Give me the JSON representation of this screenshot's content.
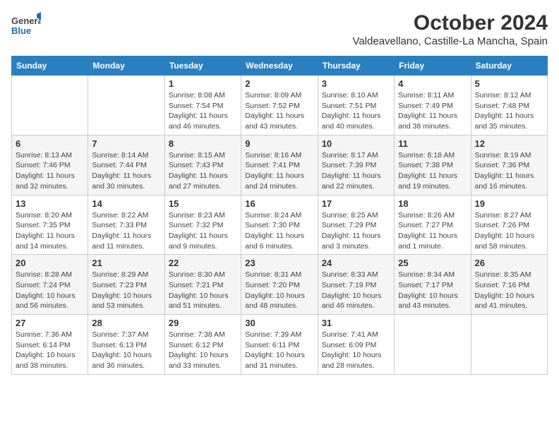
{
  "header": {
    "logo_general": "General",
    "logo_blue": "Blue",
    "title": "October 2024",
    "subtitle": "Valdeavellano, Castille-La Mancha, Spain"
  },
  "calendar": {
    "days_of_week": [
      "Sunday",
      "Monday",
      "Tuesday",
      "Wednesday",
      "Thursday",
      "Friday",
      "Saturday"
    ],
    "weeks": [
      [
        {
          "day": "",
          "sunrise": "",
          "sunset": "",
          "daylight": ""
        },
        {
          "day": "",
          "sunrise": "",
          "sunset": "",
          "daylight": ""
        },
        {
          "day": "1",
          "sunrise": "Sunrise: 8:08 AM",
          "sunset": "Sunset: 7:54 PM",
          "daylight": "Daylight: 11 hours and 46 minutes."
        },
        {
          "day": "2",
          "sunrise": "Sunrise: 8:09 AM",
          "sunset": "Sunset: 7:52 PM",
          "daylight": "Daylight: 11 hours and 43 minutes."
        },
        {
          "day": "3",
          "sunrise": "Sunrise: 8:10 AM",
          "sunset": "Sunset: 7:51 PM",
          "daylight": "Daylight: 11 hours and 40 minutes."
        },
        {
          "day": "4",
          "sunrise": "Sunrise: 8:11 AM",
          "sunset": "Sunset: 7:49 PM",
          "daylight": "Daylight: 11 hours and 38 minutes."
        },
        {
          "day": "5",
          "sunrise": "Sunrise: 8:12 AM",
          "sunset": "Sunset: 7:48 PM",
          "daylight": "Daylight: 11 hours and 35 minutes."
        }
      ],
      [
        {
          "day": "6",
          "sunrise": "Sunrise: 8:13 AM",
          "sunset": "Sunset: 7:46 PM",
          "daylight": "Daylight: 11 hours and 32 minutes."
        },
        {
          "day": "7",
          "sunrise": "Sunrise: 8:14 AM",
          "sunset": "Sunset: 7:44 PM",
          "daylight": "Daylight: 11 hours and 30 minutes."
        },
        {
          "day": "8",
          "sunrise": "Sunrise: 8:15 AM",
          "sunset": "Sunset: 7:43 PM",
          "daylight": "Daylight: 11 hours and 27 minutes."
        },
        {
          "day": "9",
          "sunrise": "Sunrise: 8:16 AM",
          "sunset": "Sunset: 7:41 PM",
          "daylight": "Daylight: 11 hours and 24 minutes."
        },
        {
          "day": "10",
          "sunrise": "Sunrise: 8:17 AM",
          "sunset": "Sunset: 7:39 PM",
          "daylight": "Daylight: 11 hours and 22 minutes."
        },
        {
          "day": "11",
          "sunrise": "Sunrise: 8:18 AM",
          "sunset": "Sunset: 7:38 PM",
          "daylight": "Daylight: 11 hours and 19 minutes."
        },
        {
          "day": "12",
          "sunrise": "Sunrise: 8:19 AM",
          "sunset": "Sunset: 7:36 PM",
          "daylight": "Daylight: 11 hours and 16 minutes."
        }
      ],
      [
        {
          "day": "13",
          "sunrise": "Sunrise: 8:20 AM",
          "sunset": "Sunset: 7:35 PM",
          "daylight": "Daylight: 11 hours and 14 minutes."
        },
        {
          "day": "14",
          "sunrise": "Sunrise: 8:22 AM",
          "sunset": "Sunset: 7:33 PM",
          "daylight": "Daylight: 11 hours and 11 minutes."
        },
        {
          "day": "15",
          "sunrise": "Sunrise: 8:23 AM",
          "sunset": "Sunset: 7:32 PM",
          "daylight": "Daylight: 11 hours and 9 minutes."
        },
        {
          "day": "16",
          "sunrise": "Sunrise: 8:24 AM",
          "sunset": "Sunset: 7:30 PM",
          "daylight": "Daylight: 11 hours and 6 minutes."
        },
        {
          "day": "17",
          "sunrise": "Sunrise: 8:25 AM",
          "sunset": "Sunset: 7:29 PM",
          "daylight": "Daylight: 11 hours and 3 minutes."
        },
        {
          "day": "18",
          "sunrise": "Sunrise: 8:26 AM",
          "sunset": "Sunset: 7:27 PM",
          "daylight": "Daylight: 11 hours and 1 minute."
        },
        {
          "day": "19",
          "sunrise": "Sunrise: 8:27 AM",
          "sunset": "Sunset: 7:26 PM",
          "daylight": "Daylight: 10 hours and 58 minutes."
        }
      ],
      [
        {
          "day": "20",
          "sunrise": "Sunrise: 8:28 AM",
          "sunset": "Sunset: 7:24 PM",
          "daylight": "Daylight: 10 hours and 56 minutes."
        },
        {
          "day": "21",
          "sunrise": "Sunrise: 8:29 AM",
          "sunset": "Sunset: 7:23 PM",
          "daylight": "Daylight: 10 hours and 53 minutes."
        },
        {
          "day": "22",
          "sunrise": "Sunrise: 8:30 AM",
          "sunset": "Sunset: 7:21 PM",
          "daylight": "Daylight: 10 hours and 51 minutes."
        },
        {
          "day": "23",
          "sunrise": "Sunrise: 8:31 AM",
          "sunset": "Sunset: 7:20 PM",
          "daylight": "Daylight: 10 hours and 48 minutes."
        },
        {
          "day": "24",
          "sunrise": "Sunrise: 8:33 AM",
          "sunset": "Sunset: 7:19 PM",
          "daylight": "Daylight: 10 hours and 46 minutes."
        },
        {
          "day": "25",
          "sunrise": "Sunrise: 8:34 AM",
          "sunset": "Sunset: 7:17 PM",
          "daylight": "Daylight: 10 hours and 43 minutes."
        },
        {
          "day": "26",
          "sunrise": "Sunrise: 8:35 AM",
          "sunset": "Sunset: 7:16 PM",
          "daylight": "Daylight: 10 hours and 41 minutes."
        }
      ],
      [
        {
          "day": "27",
          "sunrise": "Sunrise: 7:36 AM",
          "sunset": "Sunset: 6:14 PM",
          "daylight": "Daylight: 10 hours and 38 minutes."
        },
        {
          "day": "28",
          "sunrise": "Sunrise: 7:37 AM",
          "sunset": "Sunset: 6:13 PM",
          "daylight": "Daylight: 10 hours and 36 minutes."
        },
        {
          "day": "29",
          "sunrise": "Sunrise: 7:38 AM",
          "sunset": "Sunset: 6:12 PM",
          "daylight": "Daylight: 10 hours and 33 minutes."
        },
        {
          "day": "30",
          "sunrise": "Sunrise: 7:39 AM",
          "sunset": "Sunset: 6:11 PM",
          "daylight": "Daylight: 10 hours and 31 minutes."
        },
        {
          "day": "31",
          "sunrise": "Sunrise: 7:41 AM",
          "sunset": "Sunset: 6:09 PM",
          "daylight": "Daylight: 10 hours and 28 minutes."
        },
        {
          "day": "",
          "sunrise": "",
          "sunset": "",
          "daylight": ""
        },
        {
          "day": "",
          "sunrise": "",
          "sunset": "",
          "daylight": ""
        }
      ]
    ]
  }
}
